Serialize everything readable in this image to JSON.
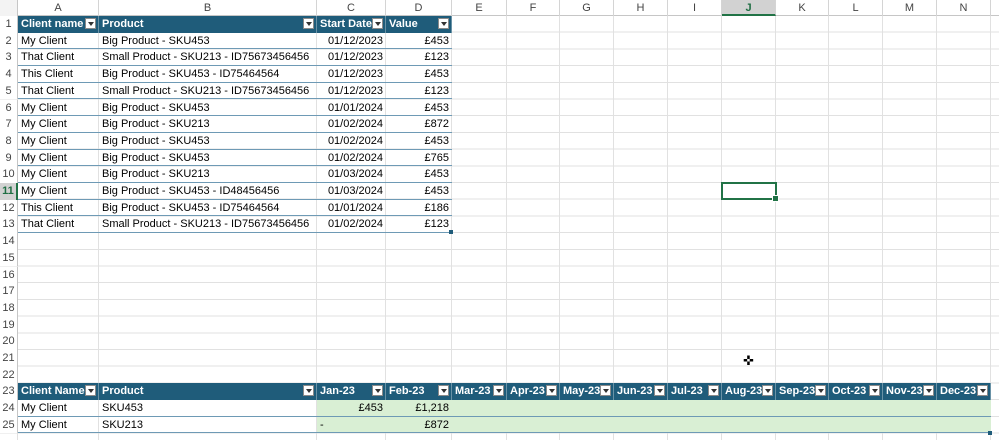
{
  "columns": [
    "A",
    "B",
    "C",
    "D",
    "E",
    "F",
    "G",
    "H",
    "I",
    "J",
    "K",
    "L",
    "M",
    "N"
  ],
  "rows": [
    "1",
    "2",
    "3",
    "4",
    "5",
    "6",
    "7",
    "8",
    "9",
    "10",
    "11",
    "12",
    "13",
    "14",
    "15",
    "16",
    "17",
    "18",
    "19",
    "20",
    "21",
    "22",
    "23",
    "24",
    "25"
  ],
  "selected_column": "J",
  "selected_row": "11",
  "table1": {
    "headers": [
      "Client name",
      "Product",
      "Start Date",
      "Value"
    ],
    "rows": [
      [
        "My Client",
        "Big Product - SKU453",
        "01/12/2023",
        "£453"
      ],
      [
        "That Client",
        "Small Product - SKU213 - ID75673456456",
        "01/12/2023",
        "£123"
      ],
      [
        "This Client",
        "Big Product - SKU453 - ID75464564",
        "01/12/2023",
        "£453"
      ],
      [
        "That Client",
        "Small Product - SKU213 - ID75673456456",
        "01/12/2023",
        "£123"
      ],
      [
        "My Client",
        "Big Product - SKU453",
        "01/01/2024",
        "£453"
      ],
      [
        "My Client",
        "Big Product - SKU213",
        "01/02/2024",
        "£872"
      ],
      [
        "My Client",
        "Big Product - SKU453",
        "01/02/2024",
        "£453"
      ],
      [
        "My Client",
        "Big Product - SKU453",
        "01/02/2024",
        "£765"
      ],
      [
        "My Client",
        "Big Product - SKU213",
        "01/03/2024",
        "£453"
      ],
      [
        "My Client",
        "Big Product - SKU453 - ID48456456",
        "01/03/2024",
        "£453"
      ],
      [
        "This Client",
        "Big Product - SKU453 - ID75464564",
        "01/01/2024",
        "£186"
      ],
      [
        "That Client",
        "Small Product - SKU213 - ID75673456456",
        "01/02/2024",
        "£123"
      ]
    ]
  },
  "table2": {
    "headers": [
      "Client Name",
      "Product",
      "Jan-23",
      "Feb-23",
      "Mar-23",
      "Apr-23",
      "May-23",
      "Jun-23",
      "Jul-23",
      "Aug-23",
      "Sep-23",
      "Oct-23",
      "Nov-23",
      "Dec-23"
    ],
    "rows": [
      [
        "My Client",
        "SKU453",
        "£453",
        "£1,218",
        "",
        "",
        "",
        "",
        "",
        "",
        "",
        "",
        "",
        ""
      ],
      [
        "My Client",
        "SKU213",
        "-",
        "£872",
        "",
        "",
        "",
        "",
        "",
        "",
        "",
        "",
        "",
        ""
      ]
    ]
  },
  "colors": {
    "table_header": "#1f5c7a",
    "selection": "#217346",
    "highlight": "#d9efd4"
  }
}
